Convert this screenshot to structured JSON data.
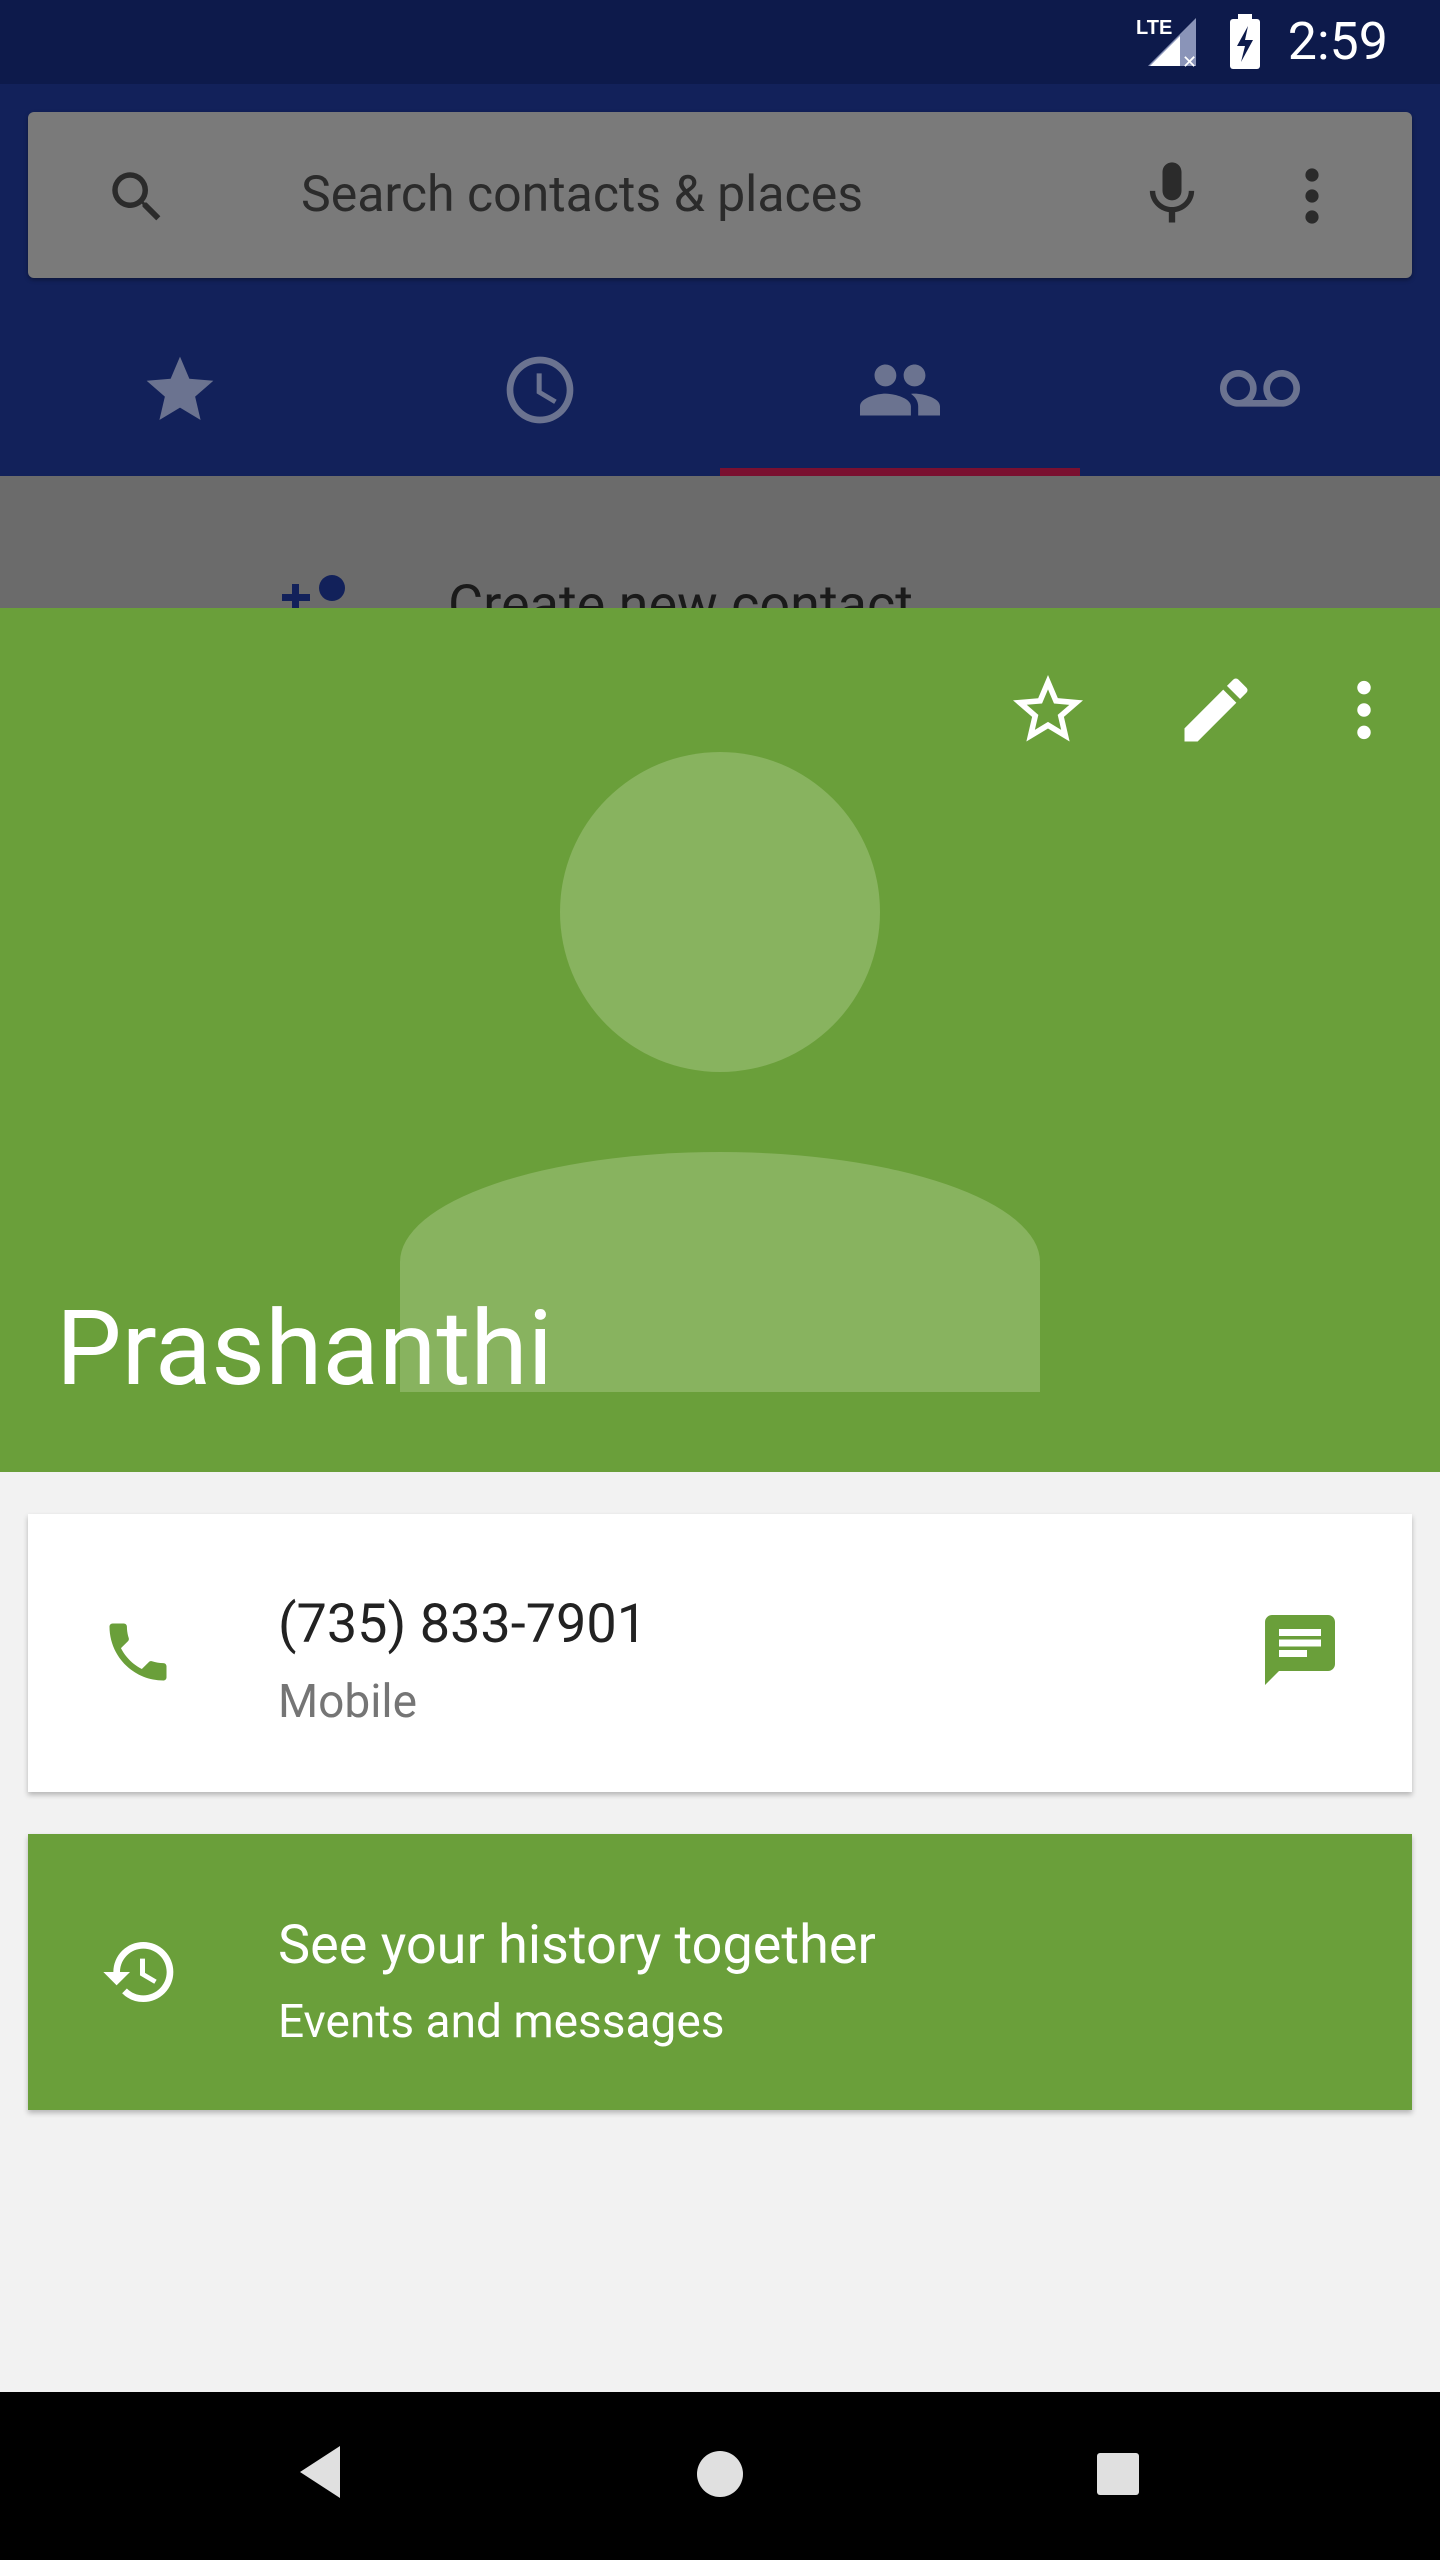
{
  "status_bar": {
    "time": "2:59",
    "network": "LTE"
  },
  "search": {
    "placeholder": "Search contacts & places"
  },
  "tabs": [
    {
      "icon": "star-icon"
    },
    {
      "icon": "clock-icon"
    },
    {
      "icon": "people-icon",
      "selected": true
    },
    {
      "icon": "voicemail-icon"
    }
  ],
  "create_contact": {
    "label": "Create new contact"
  },
  "contact": {
    "name": "Prashanthi",
    "header_color": "#6a9f3a",
    "phone": {
      "number": "(735) 833-7901",
      "type": "Mobile"
    },
    "history": {
      "title": "See your history together",
      "subtitle": "Events and messages"
    }
  },
  "colors": {
    "accent": "#6a9f3a",
    "status_bar": "#0d1a4b",
    "tab_indicator": "#7a1030"
  }
}
